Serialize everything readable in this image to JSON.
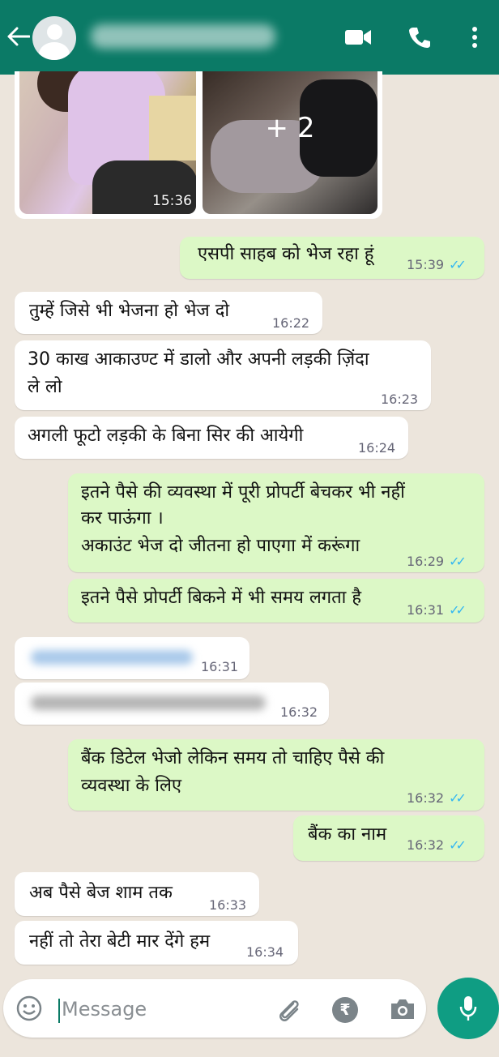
{
  "header": {
    "contact_name": "",
    "icons": [
      "back-arrow-icon",
      "avatar",
      "video-call-icon",
      "voice-call-icon",
      "more-options-icon"
    ]
  },
  "media": {
    "more_count": "+ 2",
    "time": "15:36"
  },
  "messages": [
    {
      "dir": "out",
      "text": "एसपी साहब को भेज रहा हूं",
      "time": "15:39",
      "read": true
    },
    {
      "dir": "in",
      "text": "तुम्हें जिसे भी भेजना हो भेज दो",
      "time": "16:22"
    },
    {
      "dir": "in",
      "text_line1": "30 काख आकाउण्ट में डालो और अपनी लड़की ज़िंदा",
      "text_line2": "ले लो",
      "time": "16:23"
    },
    {
      "dir": "in",
      "text": "अगली फूटो लड़की के बिना सिर की आयेगी",
      "time": "16:24"
    },
    {
      "dir": "out",
      "text_line1": "इतने पैसे की व्यवस्था में पूरी प्रोपर्टी बेचकर भी नहीं",
      "text_line2": "कर पाऊंगा ।",
      "text_line3": "अकाउंट भेज दो जीतना हो पाएगा में करूंगा",
      "time": "16:29",
      "read": true
    },
    {
      "dir": "out",
      "text": "इतने पैसे प्रोपर्टी बिकने में भी समय लगता है",
      "time": "16:31",
      "read": true
    },
    {
      "dir": "in",
      "text": "",
      "time": "16:31",
      "blurred": true
    },
    {
      "dir": "in",
      "text": "",
      "time": "16:32",
      "blurred": true
    },
    {
      "dir": "out",
      "text_line1": "बैंक डिटेल भेजो लेकिन समय तो चाहिए पैसे की",
      "text_line2": "व्यवस्था के लिए",
      "time": "16:32",
      "read": true
    },
    {
      "dir": "out",
      "text": "बैंक का नाम",
      "time": "16:32",
      "read": true
    },
    {
      "dir": "in",
      "text": "अब पैसे बेज शाम तक",
      "time": "16:33"
    },
    {
      "dir": "in",
      "text": "नहीं तो तेरा बेटी मार देंगे हम",
      "time": "16:34"
    }
  ],
  "input": {
    "placeholder": "Message"
  },
  "colors": {
    "header": "#0b7a66",
    "outgoing": "#dcf8c6",
    "incoming": "#ffffff",
    "background": "#ece5dc",
    "read_ticks": "#34b7f1",
    "mic_button": "#0f9d83"
  }
}
